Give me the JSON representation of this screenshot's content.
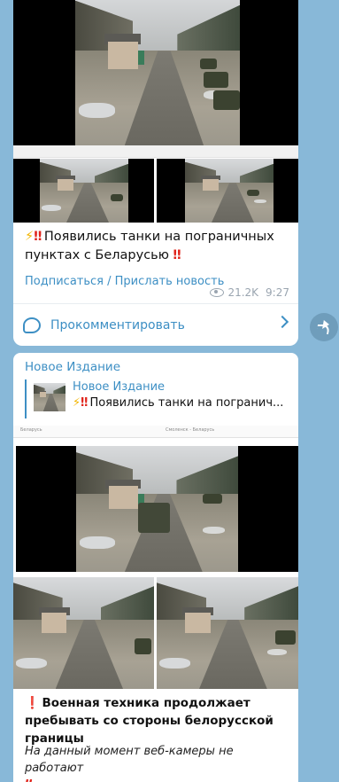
{
  "post1": {
    "text": "Появились танки на пограничных пунктах с Беларусью",
    "subscribe_link": "Подписаться",
    "separator": "/",
    "send_news_link": "Прислать новость",
    "views": "21.2K",
    "time": "9:27",
    "comment_label": "Прокомментировать",
    "icons": [
      "high-voltage-emoji",
      "double-exclamation-emoji",
      "eye-icon",
      "comment-icon",
      "chevron-right-icon",
      "share-icon"
    ]
  },
  "post2": {
    "forwarded_from": "Новое Издание",
    "reply": {
      "title": "Новое Издание",
      "text": "Появились танки на погранич..."
    },
    "cam_selects": [
      "Беларусь",
      "Смоленск - Беларусь"
    ],
    "text_bold": "Военная техника продолжает пребывать со стороны белорусской границы",
    "text_italic": "На данный момент веб-камеры не работают"
  },
  "colors": {
    "background": "#88b8d8",
    "link": "#3d8fc4",
    "meta": "#9aa5b0"
  }
}
